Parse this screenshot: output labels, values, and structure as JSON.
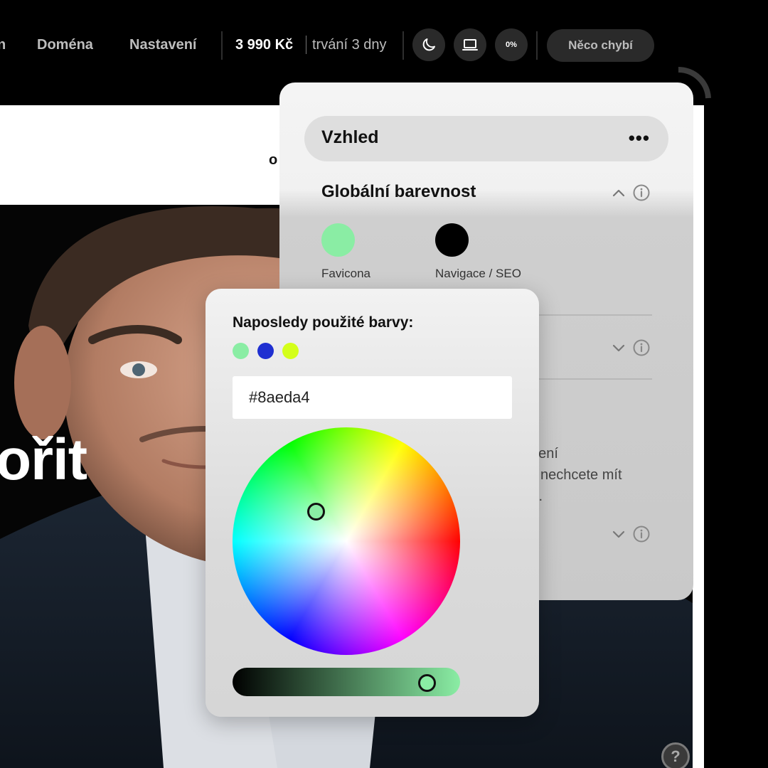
{
  "topbar": {
    "nav": [
      {
        "label": "n"
      },
      {
        "label": "Doména"
      },
      {
        "label": "Nastavení"
      }
    ],
    "price": "3 990 Kč",
    "duration": "trvání 3 dny",
    "theme_icon": "moon-icon",
    "device_icon": "laptop-icon",
    "progress_label": "0%",
    "missing_button": "Něco chybí"
  },
  "preview": {
    "nav_fragment": "o",
    "headline_fragment": "ořit",
    "help_label": "?"
  },
  "panel": {
    "title": "Vzhled",
    "menu_icon": "more-dots-icon",
    "section": {
      "title": "Globální barevnost",
      "swatches": [
        {
          "label": "Favicona",
          "color": "#8aeda4"
        },
        {
          "label": "Navigace / SEO",
          "color": "#000000"
        }
      ]
    },
    "faded_text": [
      "ožení",
      "nechcete mít",
      "t."
    ]
  },
  "picker": {
    "title": "Naposledy použité barvy:",
    "recent_colors": [
      "#8aeda4",
      "#1f2fd1",
      "#d4ff1a"
    ],
    "hex_value": "#8aeda4",
    "brightness_fraction": 0.9
  }
}
